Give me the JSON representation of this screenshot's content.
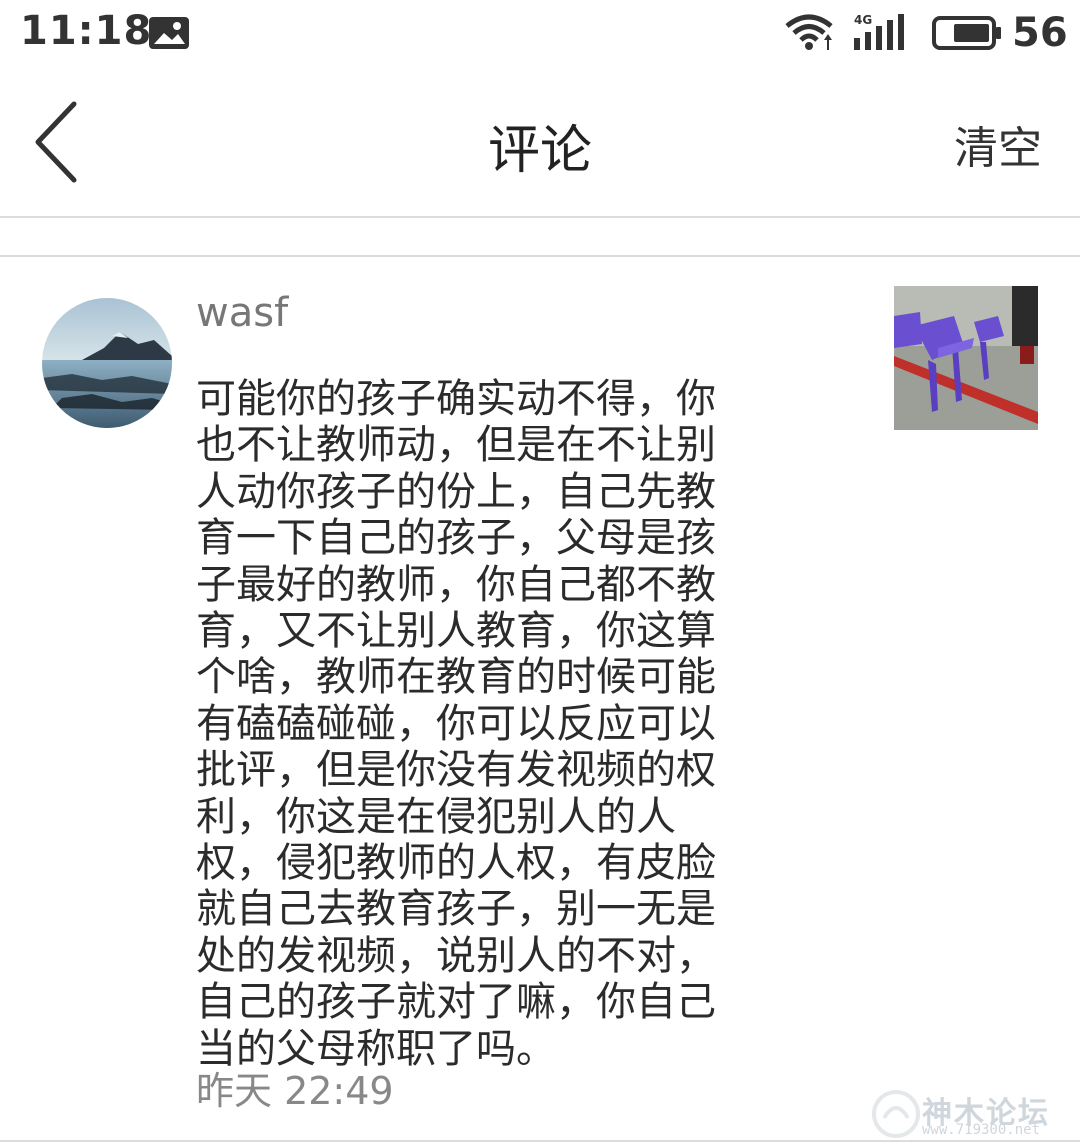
{
  "status_bar": {
    "time": "11:18",
    "network_label": "4G",
    "battery": "56"
  },
  "nav": {
    "title": "评论",
    "clear_label": "清空"
  },
  "comment": {
    "username": "wasf",
    "text": "可能你的孩子确实动不得，你也不让教师动，但是在不让别人动你孩子的份上，自己先教育一下自己的孩子，父母是孩子最好的教师，你自己都不教育，又不让别人教育，你这算个啥，教师在教育的时候可能有磕磕碰碰，你可以反应可以批评，但是你没有发视频的权利，你这是在侵犯别人的人权，侵犯教师的人权，有皮脸就自己去教育孩子，别一无是处的发视频，说别人的不对，自己的孩子就对了嘛，你自己当的父母称职了吗。",
    "time": "昨天 22:49"
  },
  "watermark": {
    "text": "神木论坛",
    "url": "www.719300.net"
  },
  "icons": {
    "back": "chevron-left-icon",
    "notification": "image-notification-icon",
    "wifi": "wifi-icon",
    "signal": "signal-icon",
    "battery": "battery-icon"
  }
}
